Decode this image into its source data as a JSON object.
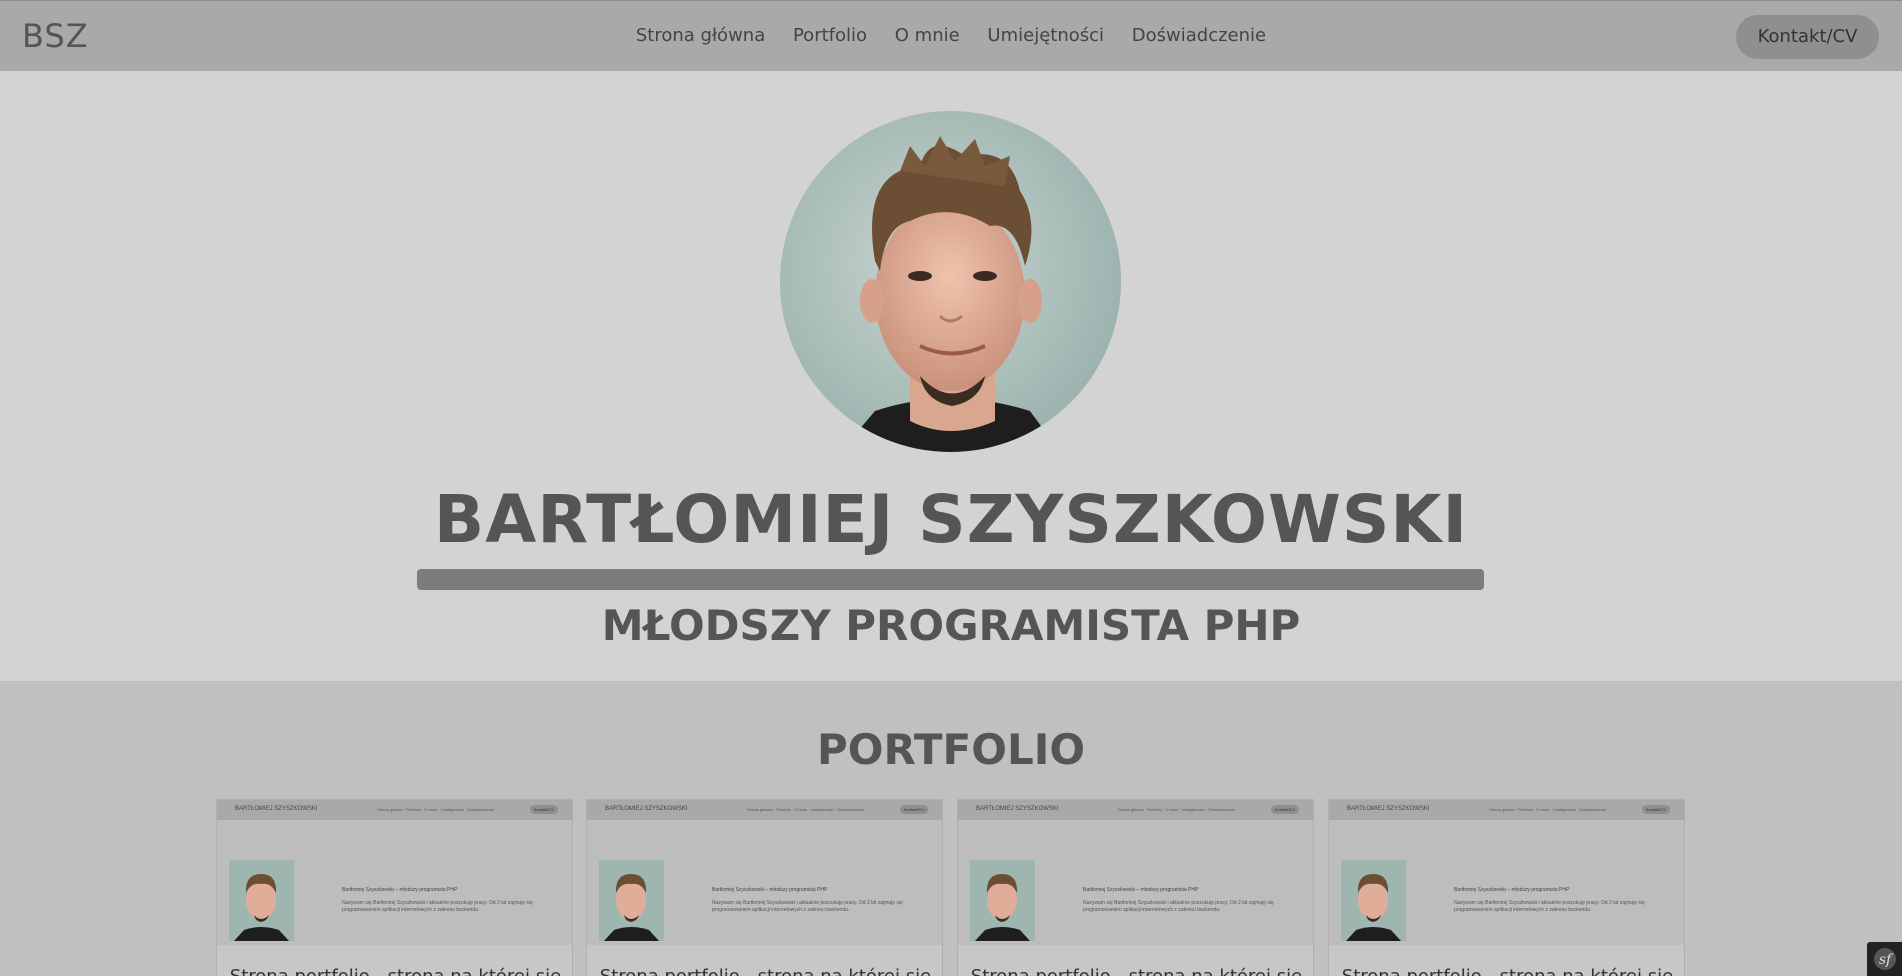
{
  "navbar": {
    "brand": "BSZ",
    "links": [
      "Strona główna",
      "Portfolio",
      "O mnie",
      "Umiejętności",
      "Doświadczenie"
    ],
    "cta": "Kontakt/CV"
  },
  "hero": {
    "name": "BARTŁOMIEJ SZYSZKOWSKI",
    "title": "MŁODSZY PROGRAMISTA PHP"
  },
  "portfolio": {
    "heading": "PORTFOLIO",
    "cards": [
      {
        "shot_name": "BARTŁOMIEJ SZYSZKOWSKI",
        "shot_links": "Strona główna · Portfolio · O mnie · Umiejętności · Doświadczenie",
        "shot_button": "Kontakt/CV",
        "shot_lead": "Bartłomiej Szyszkowski – młodszy programista PHP",
        "shot_body": "Nazywam się Bartłomiej Szyszkowski i aktualnie poszukuję pracy. Od 2 lat zajmuję się programowaniem aplikacji internetowych z zakresu backendu.",
        "title": "Strona portfolio - strona na której się"
      },
      {
        "shot_name": "BARTŁOMIEJ SZYSZKOWSKI",
        "shot_links": "Strona główna · Portfolio · O mnie · Umiejętności · Doświadczenie",
        "shot_button": "Kontakt/CV",
        "shot_lead": "Bartłomiej Szyszkowski – młodszy programista PHP",
        "shot_body": "Nazywam się Bartłomiej Szyszkowski i aktualnie poszukuję pracy. Od 2 lat zajmuję się programowaniem aplikacji internetowych z zakresu backendu.",
        "title": "Strona portfolio - strona na której się"
      },
      {
        "shot_name": "BARTŁOMIEJ SZYSZKOWSKI",
        "shot_links": "Strona główna · Portfolio · O mnie · Umiejętności · Doświadczenie",
        "shot_button": "Kontakt/CV",
        "shot_lead": "Bartłomiej Szyszkowski – młodszy programista PHP",
        "shot_body": "Nazywam się Bartłomiej Szyszkowski i aktualnie poszukuję pracy. Od 2 lat zajmuję się programowaniem aplikacji internetowych z zakresu backendu.",
        "title": "Strona portfolio - strona na której się"
      },
      {
        "shot_name": "BARTŁOMIEJ SZYSZKOWSKI",
        "shot_links": "Strona główna · Portfolio · O mnie · Umiejętności · Doświadczenie",
        "shot_button": "Kontakt/CV",
        "shot_lead": "Bartłomiej Szyszkowski – młodszy programista PHP",
        "shot_body": "Nazywam się Bartłomiej Szyszkowski i aktualnie poszukuję pracy. Od 2 lat zajmuję się programowaniem aplikacji internetowych z zakresu backendu.",
        "title": "Strona portfolio - strona na której się"
      }
    ]
  },
  "colors": {
    "navbar_bg": "#a9a9a9",
    "hero_bg": "#d3d3d3",
    "portfolio_bg": "#c0c0c0",
    "text": "#555555",
    "accent_bar": "#7c7c7c"
  },
  "icons": {
    "corner": "symfony-toolbar-icon"
  }
}
